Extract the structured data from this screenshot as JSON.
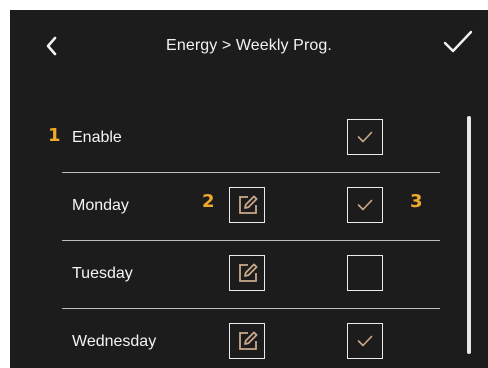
{
  "header": {
    "title": "Energy > Weekly Prog."
  },
  "callouts": {
    "one": "1",
    "two": "2",
    "three": "3"
  },
  "rows": [
    {
      "label": "Enable",
      "has_edit": false,
      "checked": true
    },
    {
      "label": "Monday",
      "has_edit": true,
      "checked": true
    },
    {
      "label": "Tuesday",
      "has_edit": true,
      "checked": false
    },
    {
      "label": "Wednesday",
      "has_edit": true,
      "checked": true
    }
  ],
  "colors": {
    "background": "#1c1c1c",
    "text": "#f4f4f4",
    "accent_check": "#c9a98a",
    "callout": "#f0a92b",
    "divider": "#bdbdbd"
  },
  "icons": {
    "back": "chevron-left-icon",
    "confirm": "checkmark-icon",
    "edit": "edit-pencil-icon",
    "check": "check-icon"
  }
}
